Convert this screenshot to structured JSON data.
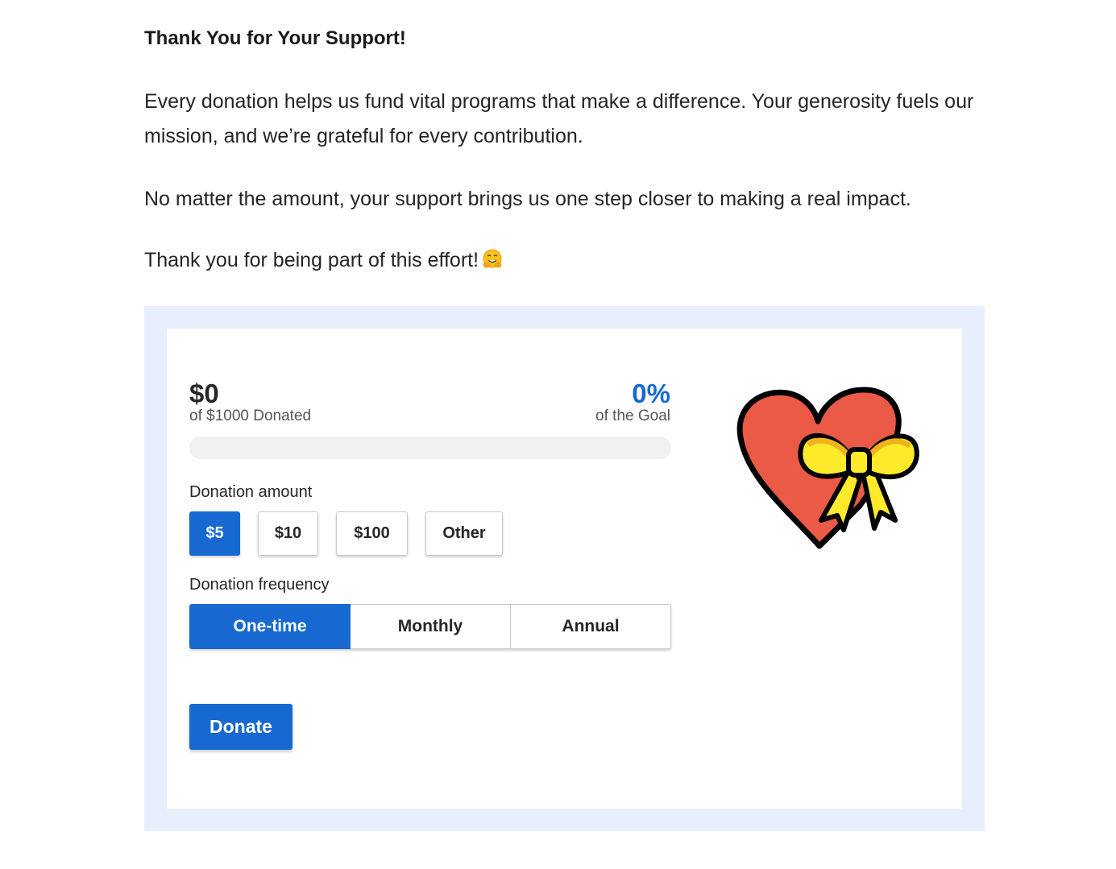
{
  "article": {
    "heading": "Thank You for Your Support!",
    "paragraph_1": "Every donation helps us fund vital programs that make a difference. Your generosity fuels our mission, and we’re grateful for every contribution.",
    "paragraph_2": "No matter the amount, your support brings us one step closer to making a real impact.",
    "paragraph_3": "Thank you for being part of this effort!",
    "paragraph_3_emoji": "hugging-face-emoji"
  },
  "widget": {
    "raised_amount": "$0",
    "raised_caption": "of $1000 Donated",
    "goal_percent": "0%",
    "goal_caption": "of the Goal",
    "progress": 0,
    "amount_label": "Donation amount",
    "amounts": [
      "$5",
      "$10",
      "$100",
      "Other"
    ],
    "selected_amount": "$5",
    "frequency_label": "Donation frequency",
    "frequencies": [
      "One-time",
      "Monthly",
      "Annual"
    ],
    "selected_frequency": "One-time",
    "donate_label": "Donate",
    "illustration": "heart-with-ribbon-icon"
  },
  "colors": {
    "accent": "#1769d1",
    "frame_background": "#e8effc",
    "progress_track": "#f0f0f0",
    "heart": "#ea5a47",
    "ribbon": "#fcea2b"
  }
}
